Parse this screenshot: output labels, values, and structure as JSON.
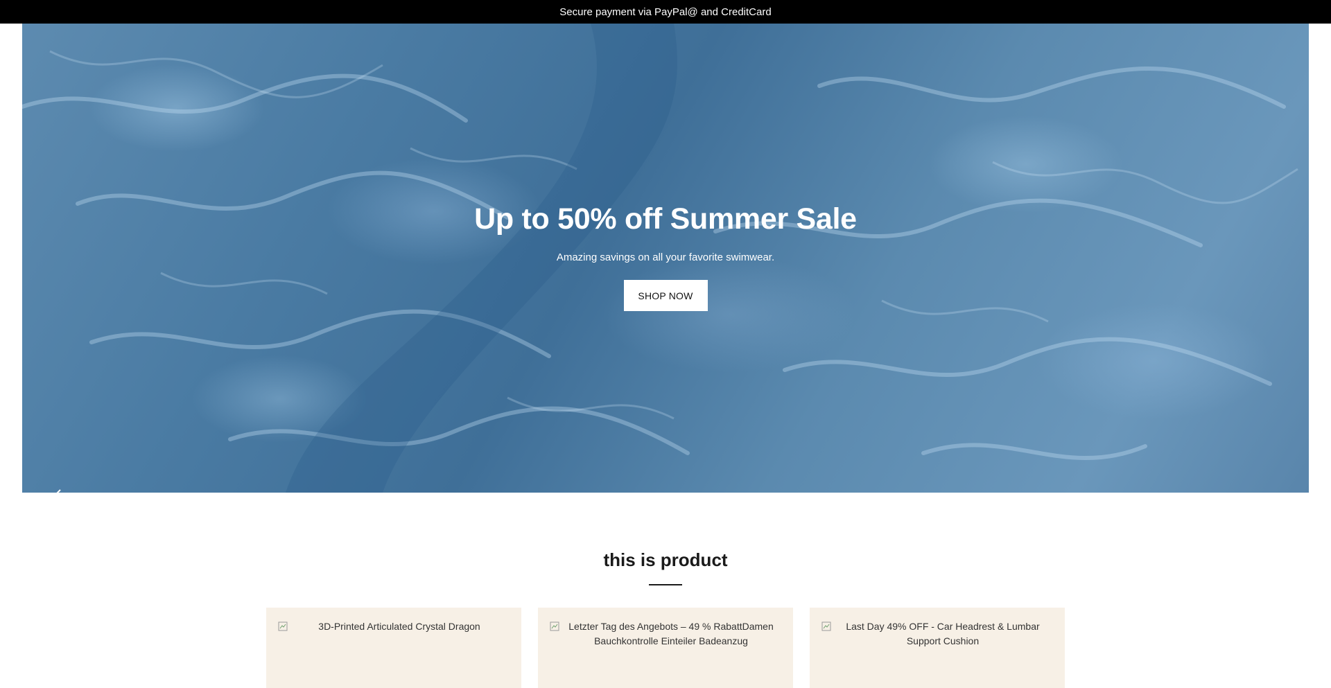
{
  "announcement": {
    "text": "Secure payment via PayPal@ and CreditCard",
    "icon": "lock-icon"
  },
  "hero": {
    "title": "Up to 50% off Summer Sale",
    "subtitle": "Amazing savings on all your favorite swimwear.",
    "cta_label": "SHOP NOW",
    "prev_icon": "arrow-left-icon",
    "next_icon": "arrow-right-icon",
    "background": "water caustics, blue"
  },
  "products_section": {
    "title": "this is product",
    "items": [
      {
        "image_alt": "3D-Printed Articulated Crystal Dragon"
      },
      {
        "image_alt": "Letzter Tag des Angebots – 49 % RabattDamen Bauchkontrolle Einteiler Badeanzug"
      },
      {
        "image_alt": "Last Day 49% OFF - Car Headrest & Lumbar Support Cushion"
      }
    ]
  },
  "colors": {
    "announcement_bg": "#000000",
    "hero_water": "#4a7ba3",
    "card_bg": "#f7f0e6"
  }
}
